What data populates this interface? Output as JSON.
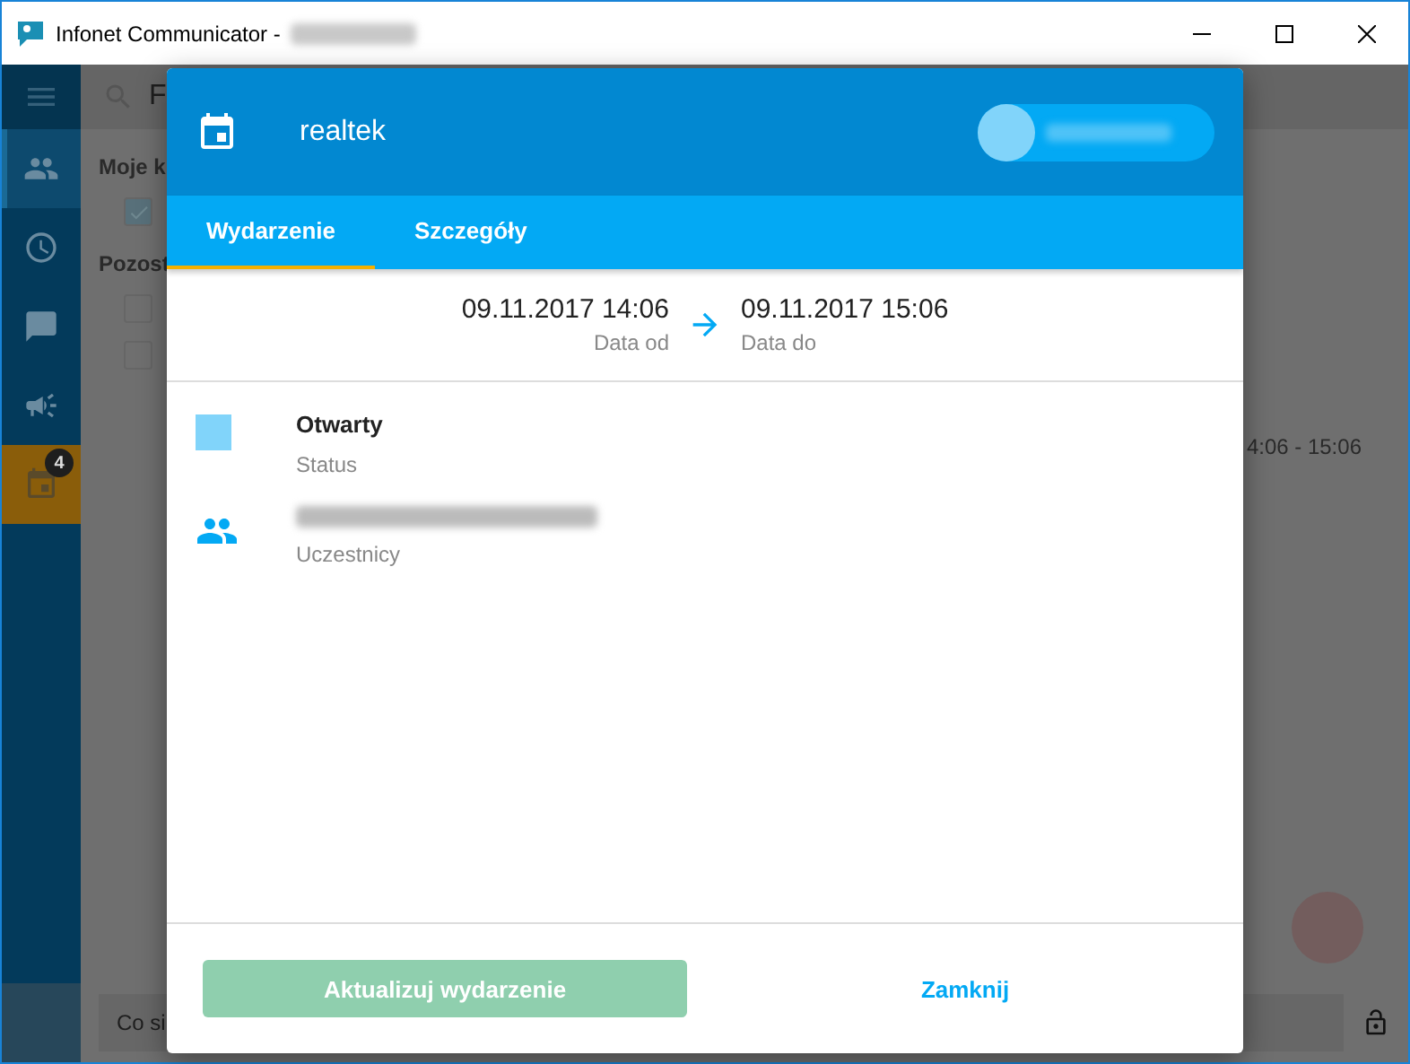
{
  "window": {
    "title": "Infonet Communicator -"
  },
  "sidebar": {
    "items": [
      {
        "kind": "people",
        "selected": true,
        "highlighted": false
      },
      {
        "kind": "clock",
        "selected": false,
        "highlighted": false
      },
      {
        "kind": "chat",
        "selected": false,
        "highlighted": false
      },
      {
        "kind": "megaphone",
        "selected": false,
        "highlighted": false
      },
      {
        "kind": "calendar",
        "selected": false,
        "highlighted": true,
        "badge": "4"
      }
    ]
  },
  "background": {
    "search_placeholder": "F",
    "sections": [
      {
        "title": "Moje k",
        "items": [
          {
            "checked": true
          }
        ]
      },
      {
        "title": "Pozost",
        "items": [
          {
            "checked": false
          },
          {
            "checked": false
          }
        ]
      }
    ],
    "time": "4:06 - 15:06",
    "message_placeholder": "Co si"
  },
  "dialog": {
    "title": "realtek",
    "tabs": [
      {
        "label": "Wydarzenie",
        "selected": true
      },
      {
        "label": "Szczegóły",
        "selected": false
      }
    ],
    "start": {
      "value": "09.11.2017 14:06",
      "label": "Data od"
    },
    "end": {
      "value": "09.11.2017 15:06",
      "label": "Data do"
    },
    "fields": [
      {
        "kind": "status",
        "value": "Otwarty",
        "label": "Status",
        "color": "#81d4fa"
      },
      {
        "kind": "participants",
        "label": "Uczestnicy"
      }
    ],
    "buttons": [
      {
        "label": "Aktualizuj wydarzenie",
        "disabled": true
      },
      {
        "label": "Zamknij",
        "disabled": false
      }
    ]
  }
}
